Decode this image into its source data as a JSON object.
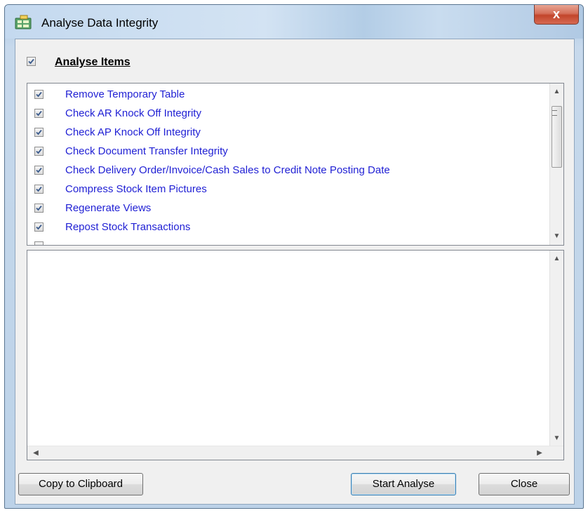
{
  "window": {
    "title": "Analyse Data Integrity",
    "close_glyph": "x"
  },
  "header": {
    "label": "Analyse Items",
    "checked": true
  },
  "items": [
    {
      "label": "Remove Temporary Table",
      "checked": true
    },
    {
      "label": "Check AR Knock Off Integrity",
      "checked": true
    },
    {
      "label": "Check AP Knock Off Integrity",
      "checked": true
    },
    {
      "label": "Check Document Transfer Integrity",
      "checked": true
    },
    {
      "label": "Check Delivery Order/Invoice/Cash Sales to Credit Note Posting Date",
      "checked": true
    },
    {
      "label": "Compress Stock Item Pictures",
      "checked": true
    },
    {
      "label": "Regenerate Views",
      "checked": true
    },
    {
      "label": "Repost Stock Transactions",
      "checked": true
    }
  ],
  "buttons": {
    "copy": "Copy to Clipboard",
    "start": "Start Analyse",
    "close": "Close"
  },
  "icons": {
    "app": "database-check-icon",
    "check": "checkmark-icon"
  },
  "colors": {
    "item_text": "#1f1fd4",
    "check_mark": "#3a5a8c"
  }
}
